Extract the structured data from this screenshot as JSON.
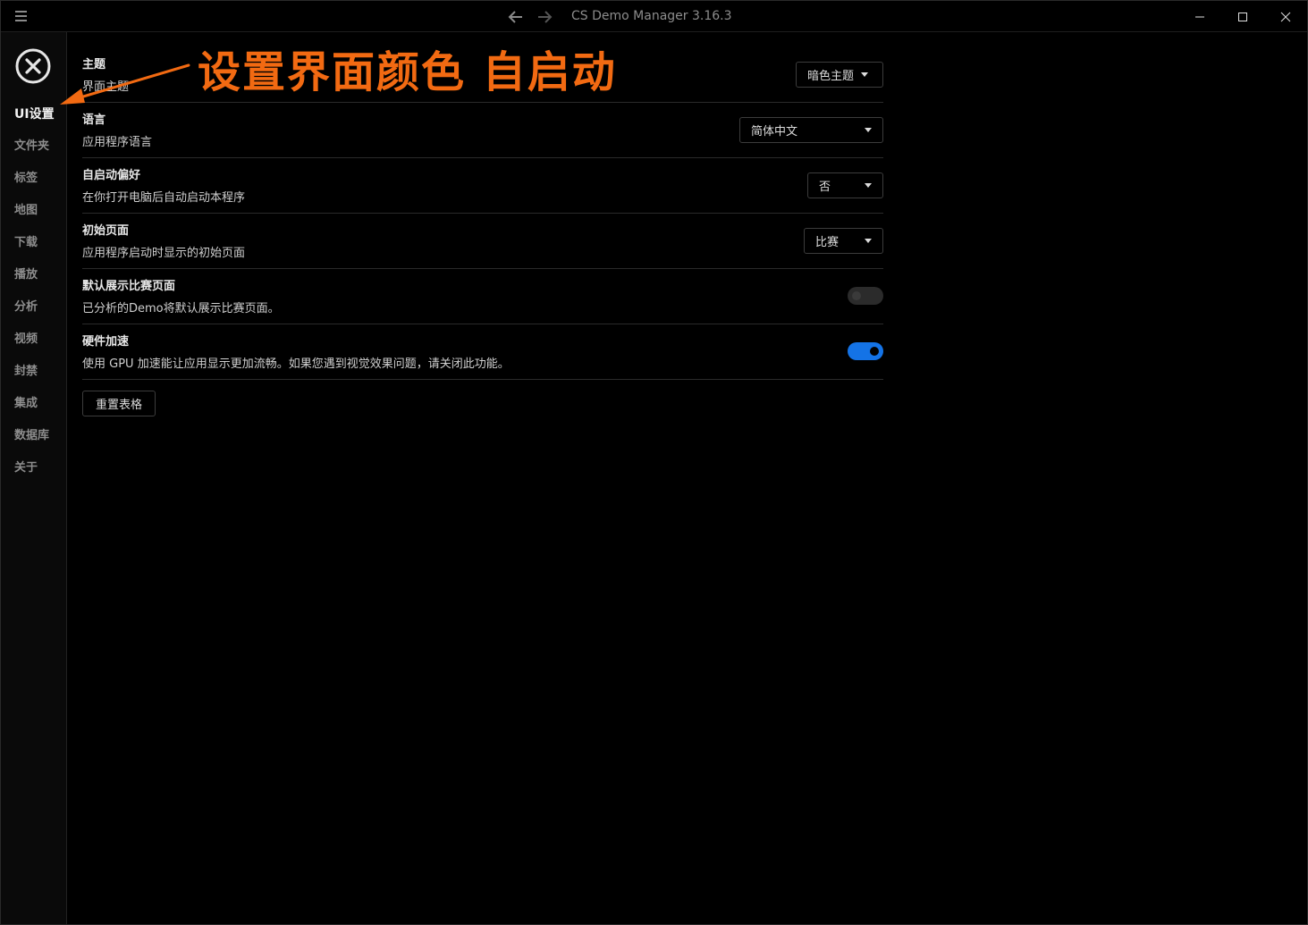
{
  "app": {
    "title": "CS Demo Manager 3.16.3"
  },
  "sidebar": {
    "items": [
      {
        "label": "UI设置",
        "active": true
      },
      {
        "label": "文件夹",
        "active": false
      },
      {
        "label": "标签",
        "active": false
      },
      {
        "label": "地图",
        "active": false
      },
      {
        "label": "下载",
        "active": false
      },
      {
        "label": "播放",
        "active": false
      },
      {
        "label": "分析",
        "active": false
      },
      {
        "label": "视频",
        "active": false
      },
      {
        "label": "封禁",
        "active": false
      },
      {
        "label": "集成",
        "active": false
      },
      {
        "label": "数据库",
        "active": false
      },
      {
        "label": "关于",
        "active": false
      }
    ]
  },
  "settings": {
    "theme": {
      "title": "主题",
      "desc": "界面主题",
      "value": "暗色主题"
    },
    "language": {
      "title": "语言",
      "desc": "应用程序语言",
      "value": "简体中文"
    },
    "autostart": {
      "title": "自启动偏好",
      "desc": "在你打开电脑后自动启动本程序",
      "value": "否"
    },
    "start_page": {
      "title": "初始页面",
      "desc": "应用程序启动时显示的初始页面",
      "value": "比赛"
    },
    "default_match": {
      "title": "默认展示比赛页面",
      "desc": "已分析的Demo将默认展示比赛页面。",
      "enabled": false
    },
    "hw_accel": {
      "title": "硬件加速",
      "desc": "使用 GPU 加速能让应用显示更加流畅。如果您遇到视觉效果问题，请关闭此功能。",
      "enabled": true
    },
    "reset_label": "重置表格"
  },
  "annotation": {
    "text": "设置界面颜色 自启动",
    "color": "#f26a12"
  },
  "colors": {
    "accent": "#1473e6",
    "annotation": "#f26a12"
  }
}
